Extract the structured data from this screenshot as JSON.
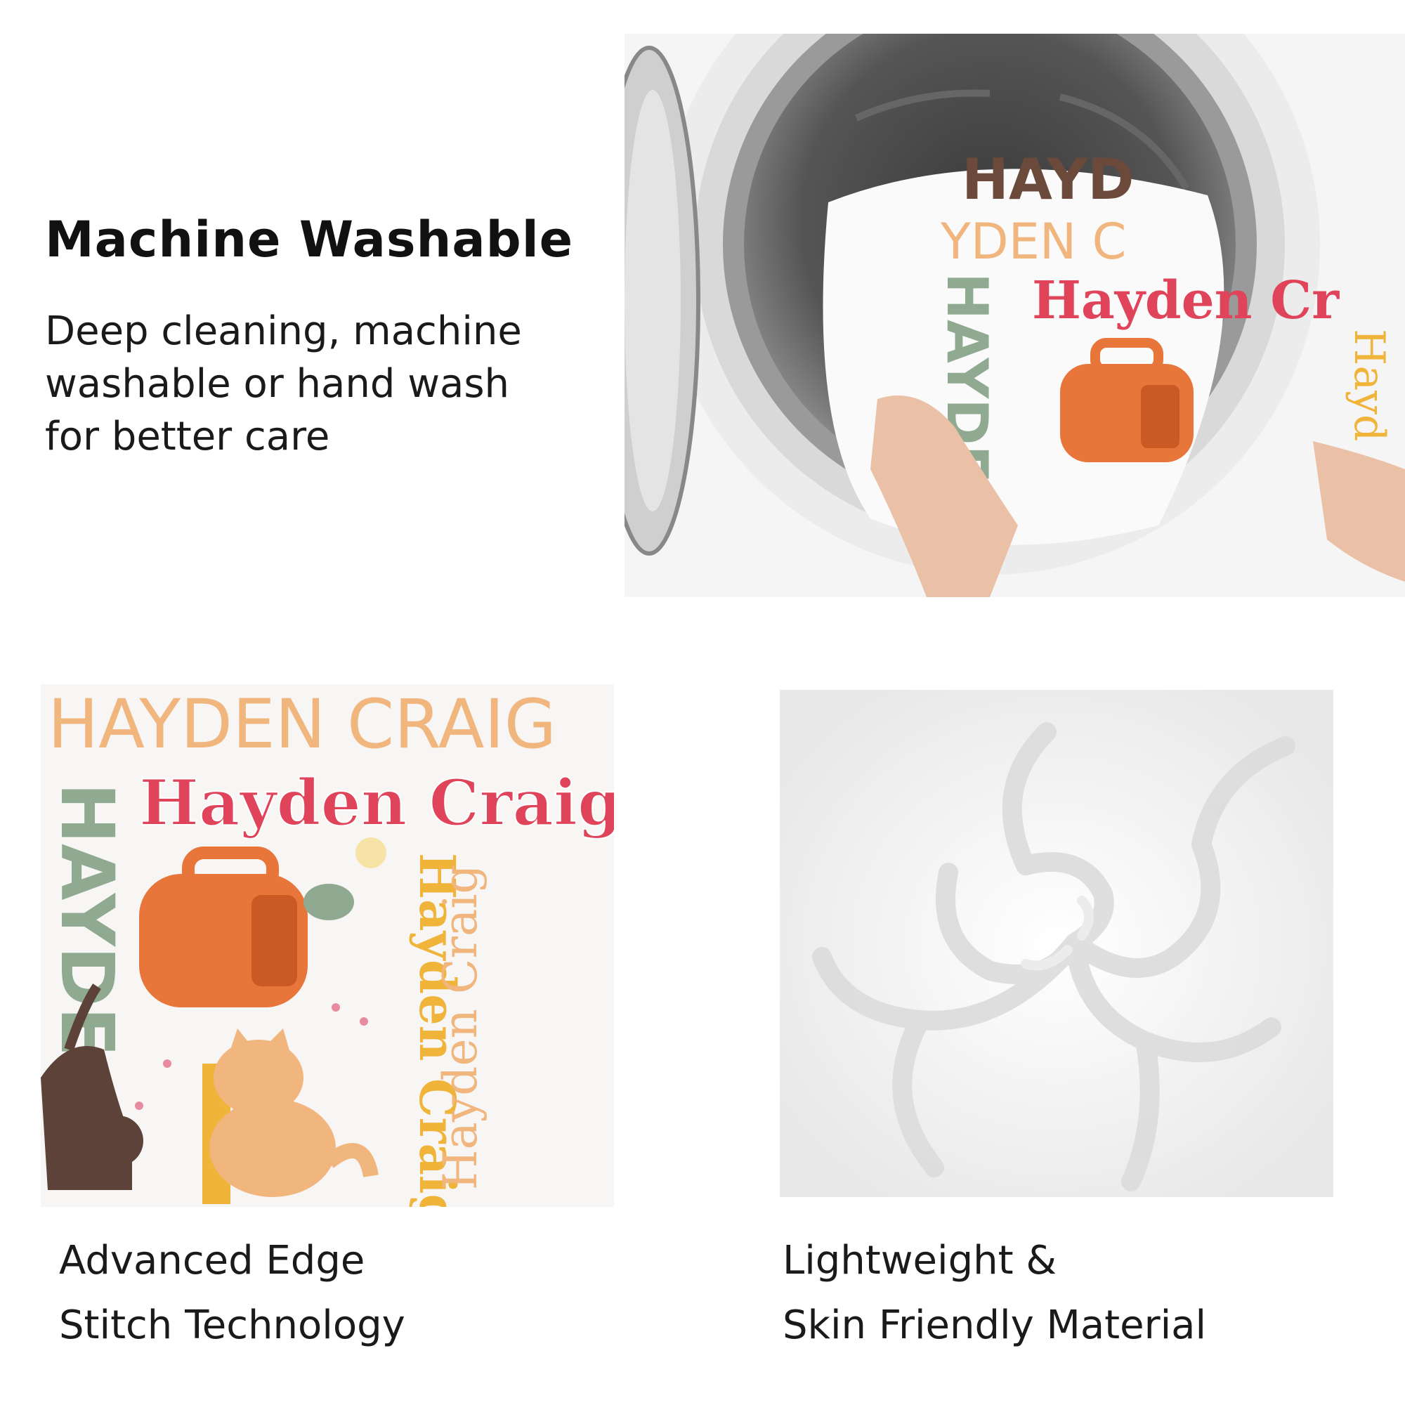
{
  "feature_wash": {
    "title": "Machine Washable",
    "description_lines": [
      "Deep cleaning, machine",
      "washable or hand wash",
      "for better care"
    ]
  },
  "feature_edge": {
    "caption_lines": [
      "Advanced Edge",
      "Stitch Technology"
    ]
  },
  "feature_material": {
    "caption_lines": [
      "Lightweight &",
      "Skin Friendly Material"
    ]
  },
  "blanket_print": {
    "name_script": "Hayden Craig",
    "name_caps": "HAYDEN CRAIG",
    "name_block": "HAYDE",
    "name_vertical": "Hayden Craig",
    "name_cursive": "Hayden Craig"
  },
  "washer_print": {
    "name_script": "Hayden Cr",
    "name_caps": "YDEN C",
    "name_top": "HAYD",
    "name_block": "HAYDE",
    "name_side": "Hayd"
  },
  "colors": {
    "red": "#e0445a",
    "orange": "#e8753a",
    "sage": "#8faa90",
    "yellow": "#f0b43a",
    "peach": "#f1b57e",
    "brown": "#5c4238"
  }
}
